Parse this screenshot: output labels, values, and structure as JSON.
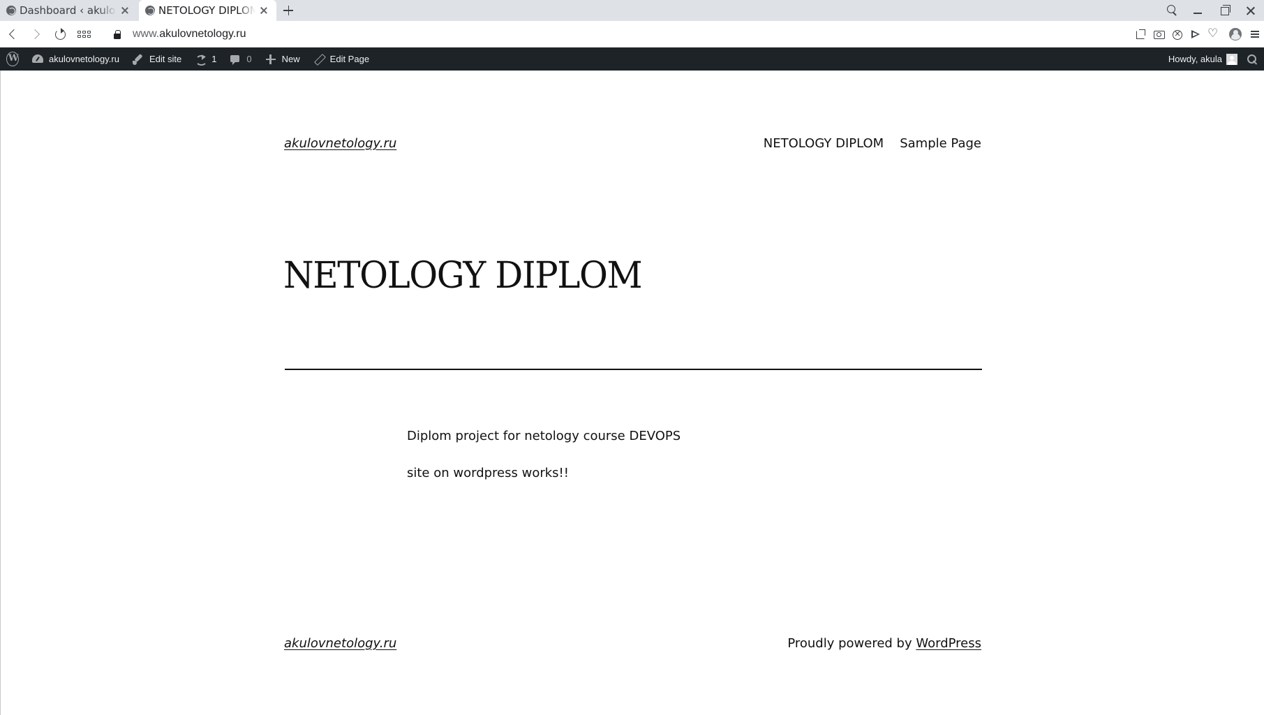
{
  "browser": {
    "tabs": [
      {
        "title": "Dashboard ‹ akulovnetology.ru",
        "active": false
      },
      {
        "title": "NETOLOGY DIPLOM – akulovnetology.ru",
        "active": true
      }
    ],
    "url_prefix": "www.",
    "url_domain": "akulovnetology.ru"
  },
  "adminbar": {
    "site_name": "akulovnetology.ru",
    "edit_site": "Edit site",
    "updates_count": "1",
    "comments_count": "0",
    "new_label": "New",
    "edit_page": "Edit Page",
    "howdy": "Howdy, akula"
  },
  "site": {
    "header_title": "akulovnetology.ru",
    "nav": [
      "NETOLOGY DIPLOM",
      "Sample Page"
    ],
    "post_title": "NETOLOGY DIPLOM",
    "paragraphs": [
      "Diplom project for netology course DEVOPS",
      "site on wordpress works!!"
    ],
    "footer_title": "akulovnetology.ru",
    "powered_text": "Proudly powered by ",
    "powered_link": "WordPress"
  },
  "icons": {
    "adminbar": [
      "wordpress-logo-icon",
      "dashboard-icon",
      "brush-icon",
      "update-icon",
      "comment-icon",
      "plus-icon",
      "pencil-icon",
      "search-icon"
    ],
    "toolbar": [
      "share-icon",
      "camera-icon",
      "shield-icon",
      "send-icon",
      "heart-icon",
      "profile-icon",
      "menu-icon"
    ]
  },
  "colors": {
    "adminbar_bg": "#1d2327",
    "tabstrip_bg": "#dee1e6",
    "text": "#111111"
  }
}
